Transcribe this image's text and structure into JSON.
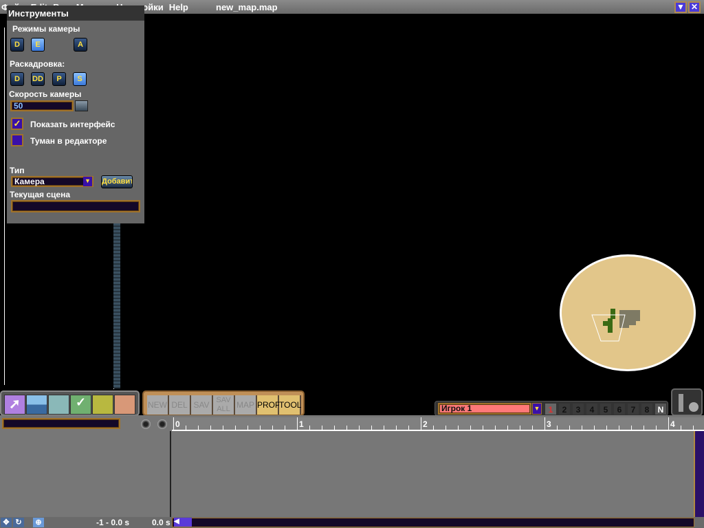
{
  "titlebar": {
    "menu": [
      "Файл",
      "Edit",
      "Вид",
      "Модули",
      "Настройки",
      "Help"
    ],
    "file": "new_map.map",
    "minimize_icon": "▼",
    "close_icon": "✕"
  },
  "tools": {
    "title": "Инструменты",
    "camera_modes_label": "Режимы камеры",
    "camera_modes": [
      "D",
      "E",
      "A"
    ],
    "storyboard_label": "Раскадровка:",
    "storyboard": [
      "D",
      "DD",
      "P",
      "S"
    ],
    "speed_label": "Скорость камеры",
    "speed_value": "50",
    "show_ui_label": "Показать интерфейс",
    "show_ui_checked": true,
    "fog_label": "Туман в редакторе",
    "fog_checked": false,
    "type_label": "Тип",
    "type_value": "Камера",
    "add_button": "Добавить",
    "current_scene_label": "Текущая сцена",
    "current_scene_value": ""
  },
  "toolbar2": [
    "NEW",
    "DEL",
    "SAV",
    "SAV ALL",
    "MAP",
    "PROP",
    "TOOL"
  ],
  "player": {
    "name": "Игрок 1",
    "numbers": [
      "1",
      "2",
      "3",
      "4",
      "5",
      "6",
      "7",
      "8",
      "N"
    ]
  },
  "ruler": {
    "labels": [
      "0",
      "1",
      "2",
      "3",
      "4"
    ]
  },
  "status": {
    "range": "-1 - 0.0 s",
    "time": "0.0 s"
  },
  "colors": {
    "minimap": "#e2c68a",
    "player_field": "#ff7878"
  }
}
